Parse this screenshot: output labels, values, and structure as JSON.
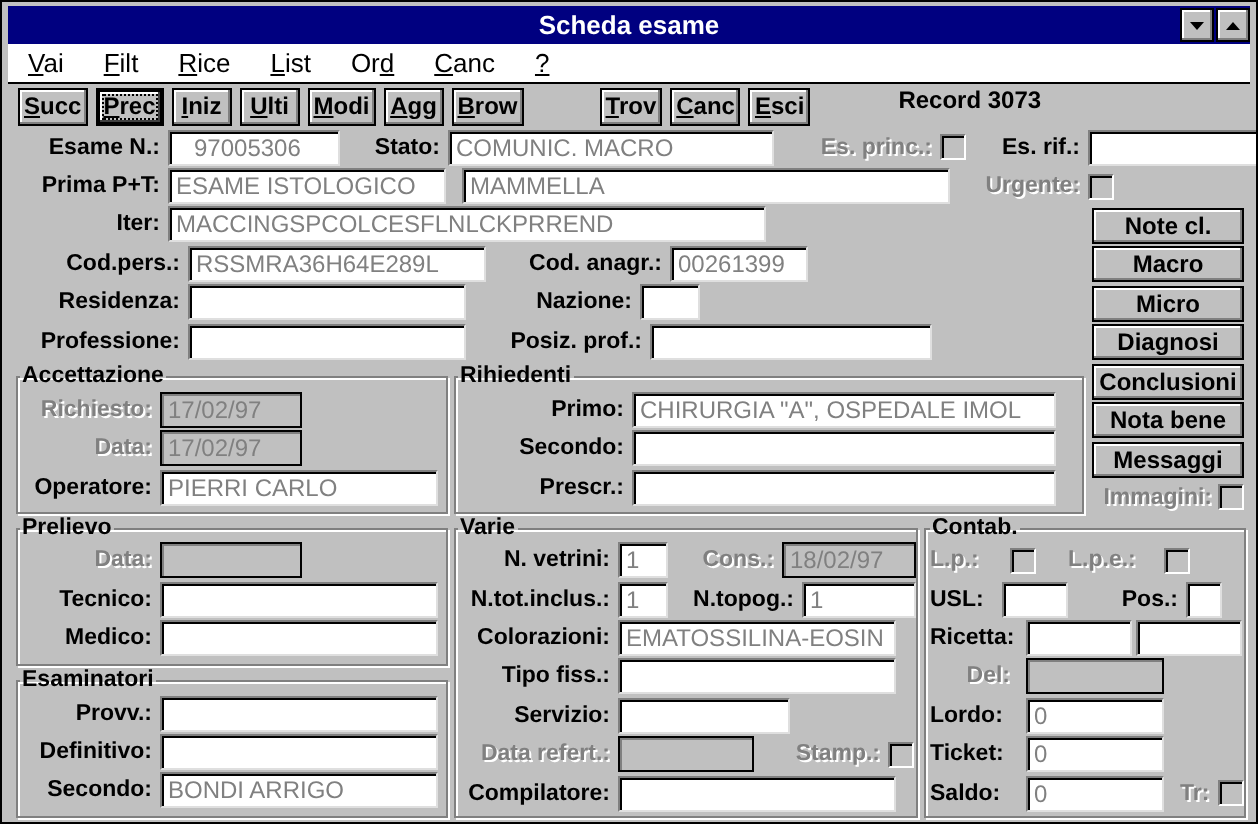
{
  "window": {
    "title": "Scheda esame"
  },
  "menu": [
    {
      "label": "Vai"
    },
    {
      "label": "Filt"
    },
    {
      "label": "Rice"
    },
    {
      "label": "List"
    },
    {
      "label": "Ord"
    },
    {
      "label": "Canc"
    },
    {
      "label": "?"
    }
  ],
  "toolbar": {
    "navigation": [
      {
        "label": "Succ",
        "focused": false
      },
      {
        "label": "Prec",
        "focused": true
      },
      {
        "label": "Iniz",
        "focused": false
      },
      {
        "label": "Ulti",
        "focused": false
      },
      {
        "label": "Modi",
        "focused": false
      },
      {
        "label": "Agg",
        "focused": false
      },
      {
        "label": "Brow",
        "focused": false
      }
    ],
    "actions": [
      {
        "label": "Trov",
        "focused": false
      },
      {
        "label": "Canc",
        "focused": false
      },
      {
        "label": "Esci",
        "focused": false
      }
    ]
  },
  "record": "Record 3073",
  "header": {
    "esame_n": {
      "label": "Esame N.:",
      "value": "97005306"
    },
    "stato": {
      "label": "Stato:",
      "value": "COMUNIC. MACRO"
    },
    "es_princ": {
      "label": "Es. princ.:",
      "checked": false,
      "disabled": true
    },
    "es_rif": {
      "label": "Es. rif.:"
    },
    "prima_pt": {
      "label": "Prima P+T:",
      "value": "ESAME ISTOLOGICO"
    },
    "sede": {
      "value": "MAMMELLA"
    },
    "urgente": {
      "label": "Urgente:",
      "checked": false,
      "disabled": true
    },
    "iter": {
      "label": "Iter:",
      "value": "MACCINGSPCOLCESFLNLCKPRREND"
    },
    "cod_pers": {
      "label": "Cod.pers.:",
      "value": "RSSMRA36H64E289L"
    },
    "cod_anagr": {
      "label": "Cod. anagr.:",
      "value": "00261399"
    },
    "residenza": {
      "label": "Residenza:"
    },
    "nazione": {
      "label": "Nazione:"
    },
    "professione": {
      "label": "Professione:"
    },
    "posiz_prof": {
      "label": "Posiz. prof.:"
    }
  },
  "side_buttons": [
    "Note cl.",
    "Macro",
    "Micro",
    "Diagnosi",
    "Conclusioni",
    "Nota bene",
    "Messaggi"
  ],
  "immagini": {
    "label": "Immagini:",
    "checked": false,
    "disabled": true
  },
  "accettazione": {
    "title": "Accettazione",
    "fields": [
      {
        "label": "Richiesto:",
        "value": "17/02/97",
        "disabled": true
      },
      {
        "label": "Data:",
        "value": "17/02/97",
        "disabled": true
      },
      {
        "label": "Operatore:",
        "value": "PIERRI CARLO"
      }
    ]
  },
  "prelievo": {
    "title": "Prelievo",
    "fields": [
      {
        "label": "Data:",
        "disabled": true
      },
      {
        "label": "Tecnico:"
      },
      {
        "label": "Medico:"
      }
    ]
  },
  "esaminatori": {
    "title": "Esaminatori",
    "fields": [
      {
        "label": "Provv.:"
      },
      {
        "label": "Definitivo:"
      },
      {
        "label": "Secondo:",
        "value": "BONDI ARRIGO"
      }
    ]
  },
  "richiedenti": {
    "title": "Rihiedenti",
    "fields": [
      {
        "label": "Primo:",
        "value": "CHIRURGIA \"A\", OSPEDALE IMOL"
      },
      {
        "label": "Secondo:"
      },
      {
        "label": "Prescr.:"
      }
    ]
  },
  "varie": {
    "title": "Varie",
    "n_vetrini": {
      "label": "N. vetrini:",
      "value": "1"
    },
    "cons": {
      "label": "Cons.:",
      "value": "18/02/97",
      "disabled": true
    },
    "n_tot_inclus": {
      "label": "N.tot.inclus.:",
      "value": "1"
    },
    "n_topog": {
      "label": "N.topog.:",
      "value": "1"
    },
    "colorazioni": {
      "label": "Colorazioni:",
      "value": "EMATOSSILINA-EOSIN"
    },
    "tipo_fiss": {
      "label": "Tipo fiss.:"
    },
    "servizio": {
      "label": "Servizio:"
    },
    "data_refert": {
      "label": "Data refert.:",
      "disabled": true
    },
    "stamp": {
      "label": "Stamp.:",
      "checked": false,
      "disabled": true
    },
    "compilatore": {
      "label": "Compilatore:"
    }
  },
  "contab": {
    "title": "Contab.",
    "lp": {
      "label": "L.p.:",
      "checked": false,
      "disabled": true
    },
    "lpe": {
      "label": "L.p.e.:",
      "checked": false,
      "disabled": true
    },
    "usl": {
      "label": "USL:"
    },
    "pos": {
      "label": "Pos.:"
    },
    "ricetta": {
      "label": "Ricetta:"
    },
    "del": {
      "label": "Del:",
      "disabled": true
    },
    "lordo": {
      "label": "Lordo:",
      "value": "0"
    },
    "ticket": {
      "label": "Ticket:",
      "value": "0"
    },
    "saldo": {
      "label": "Saldo:",
      "value": "0"
    },
    "tr": {
      "label": "Tr:",
      "checked": false,
      "disabled": true
    }
  }
}
